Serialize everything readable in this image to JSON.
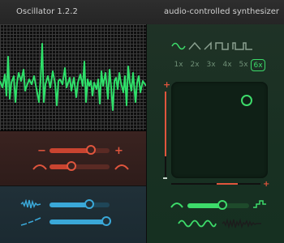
{
  "app": {
    "title": "Oscillator 1.2.2",
    "subtitle": "audio-controlled synthesizer"
  },
  "colors": {
    "green_accent": "#3ddb6a",
    "red_accent": "#e0553d",
    "blue_accent": "#3aa8d8"
  },
  "oscilloscope": {
    "label": ""
  },
  "red_panel": {
    "decrease_label": "−",
    "increase_label": "+",
    "slider1_value": 0.68,
    "slider2_value": 0.35
  },
  "blue_panel": {
    "slider1_value": 0.6,
    "slider2_value": 0.95
  },
  "right_panel": {
    "waveforms": [
      "sine-wave-icon",
      "triangle-wave-icon",
      "sawtooth-wave-icon",
      "square-wave-icon",
      "pulse-wave-icon"
    ],
    "multipliers": [
      "1x",
      "2x",
      "3x",
      "4x",
      "5x",
      "6x"
    ],
    "selected_multiplier": "6x",
    "pad_x": 0.8,
    "pad_y": 0.83,
    "vertical_plus": "+",
    "horizontal_plus": "+",
    "bottom_slider_value": 0.55
  }
}
